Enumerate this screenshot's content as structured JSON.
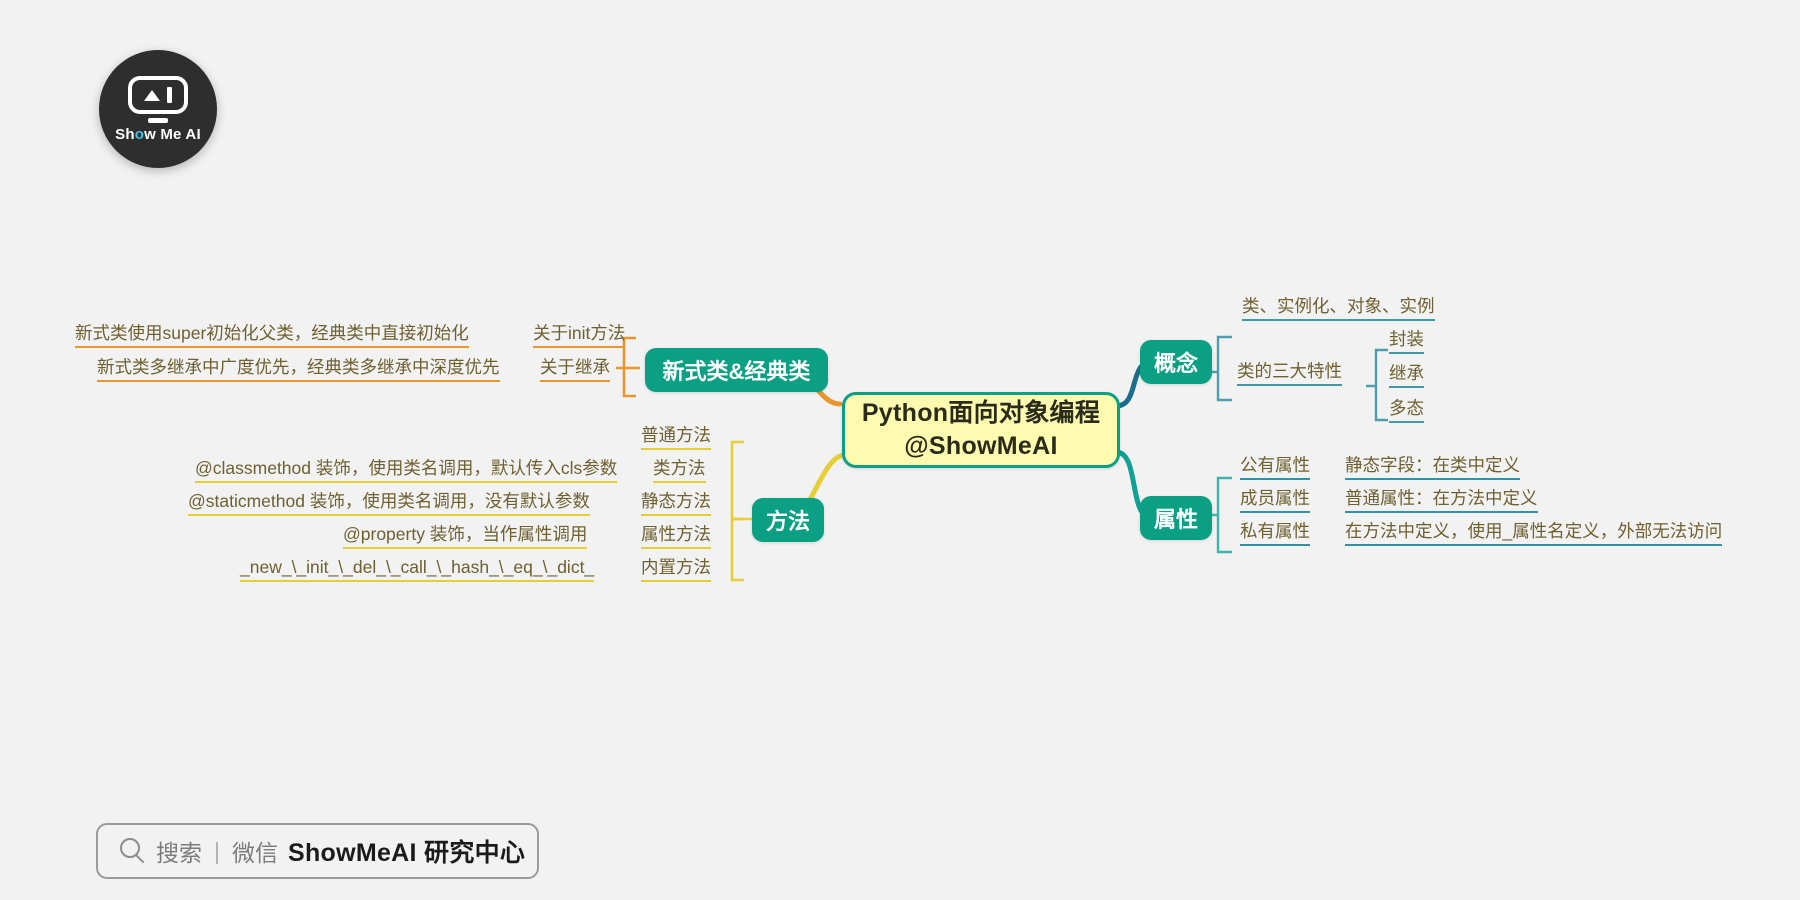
{
  "page": {
    "background": "#f2f2f2",
    "title": "Python面向对象编程 思维导图"
  },
  "logo": {
    "name": "ShowMeAI",
    "text_show": "Sh",
    "text_o": "o",
    "text_rest": "w Me AI"
  },
  "root": {
    "line1": "Python面向对象编程",
    "line2": "@ShowMeAI",
    "fill": "#fdfbb0",
    "border": "#0ba084"
  },
  "branches": {
    "new_classic": {
      "label": "新式类&经典类",
      "color": "#e8962e",
      "node_fill": "#0ba084",
      "children": [
        {
          "label": "关于init方法",
          "detail": "新式类使用super初始化父类，经典类中直接初始化"
        },
        {
          "label": "关于继承",
          "detail": "新式类多继承中广度优先，经典类多继承中深度优先"
        }
      ]
    },
    "methods": {
      "label": "方法",
      "color": "#e6cf36",
      "node_fill": "#0ba084",
      "children": [
        {
          "label": "普通方法",
          "detail": ""
        },
        {
          "label": "类方法",
          "detail": "@classmethod 装饰，使用类名调用，默认传入cls参数"
        },
        {
          "label": "静态方法",
          "detail": "@staticmethod 装饰，使用类名调用，没有默认参数"
        },
        {
          "label": "属性方法",
          "detail": "@property 装饰，当作属性调用"
        },
        {
          "label": "内置方法",
          "detail": "_new_\\_init_\\_del_\\_call_\\_hash_\\_eq_\\_dict_"
        }
      ]
    },
    "concept": {
      "label": "概念",
      "color": "#1b6f8c",
      "node_fill": "#0ba084",
      "children": [
        {
          "label": "类、实例化、对象、实例",
          "detail": ""
        },
        {
          "label": "类的三大特性",
          "detail": ""
        }
      ],
      "grandchildren": [
        "封装",
        "继承",
        "多态"
      ]
    },
    "attributes": {
      "label": "属性",
      "color": "#2f9fa8",
      "node_fill": "#0ba084",
      "children": [
        {
          "label": "公有属性",
          "detail": "静态字段：在类中定义"
        },
        {
          "label": "成员属性",
          "detail": "普通属性：在方法中定义"
        },
        {
          "label": "私有属性",
          "detail": "在方法中定义，使用_属性名定义，外部无法访问"
        }
      ]
    }
  },
  "footer": {
    "icon": "search-icon",
    "prefix": "搜索",
    "divider": "|",
    "channel": "微信",
    "brand": "ShowMeAI 研究中心"
  }
}
